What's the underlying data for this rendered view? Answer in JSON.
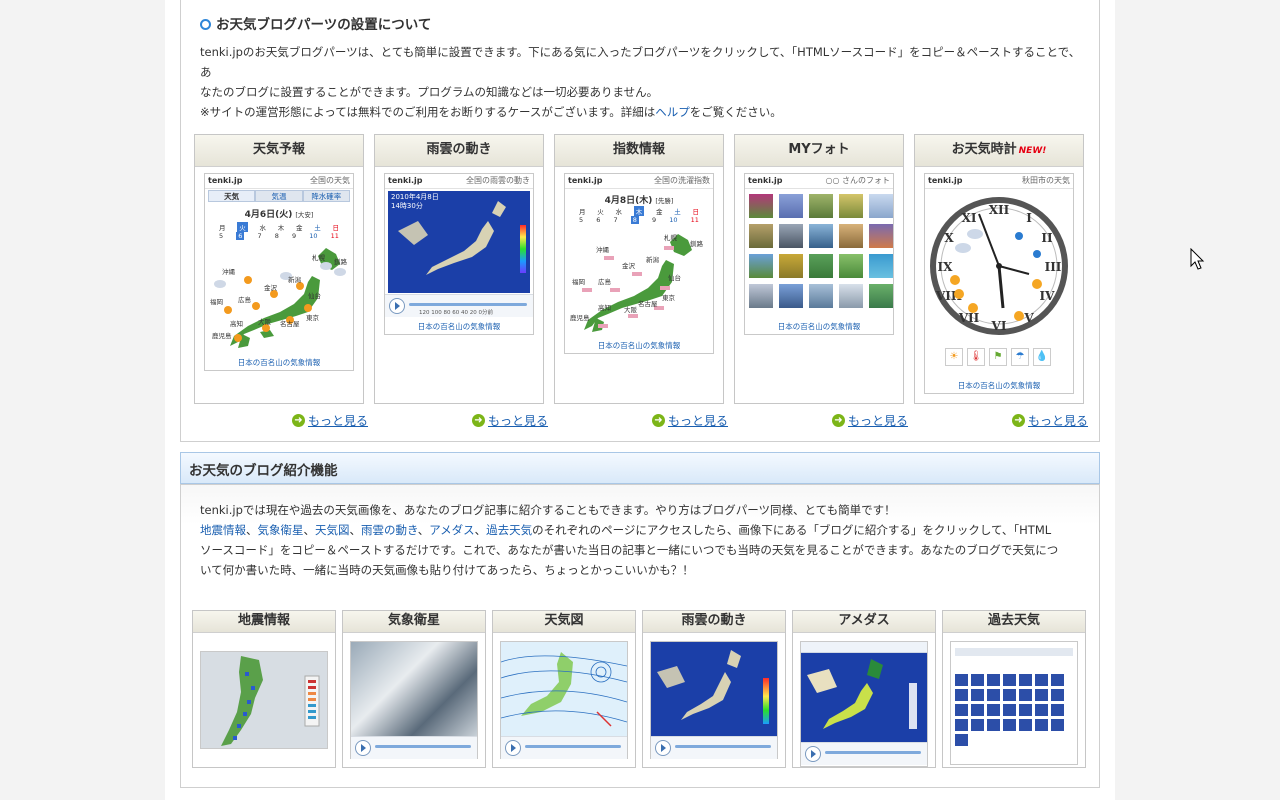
{
  "intro": {
    "title": "お天気ブログパーツの設置について",
    "line1": "tenki.jpのお天気ブログパーツは、とても簡単に設置できます。下にある気に入ったブログパーツをクリックして、「HTMLソースコード」をコピー＆ペーストすることで、あ",
    "line2": "なたのブログに設置することができます。プログラムの知識などは一切必要ありません。",
    "line3_before": "※サイトの運営形態によっては無料でのご利用をお断りするケースがございます。詳細は",
    "line3_link": "ヘルプ",
    "line3_after": "をご覧ください。"
  },
  "parts": [
    {
      "title": "天気予報",
      "widget_brand": "tenki.jp",
      "widget_sub": "全国の天気",
      "footer": "日本の百名山の気象情報",
      "date": "4月6日(火)",
      "extra": "[大安]",
      "tabs": [
        "天気",
        "気温",
        "降水確率"
      ]
    },
    {
      "title": "雨雲の動き",
      "widget_brand": "tenki.jp",
      "widget_sub": "全国の雨雲の動き",
      "footer": "日本の百名山の気象情報",
      "date": "2010年4月8日",
      "time": "14時30分",
      "scale": "120 100 80 60 40 20 0分前"
    },
    {
      "title": "指数情報",
      "widget_brand": "tenki.jp",
      "widget_sub": "全国の洗濯指数",
      "footer": "日本の百名山の気象情報",
      "date": "4月8日(木)",
      "extra": "[先勝]"
    },
    {
      "title": "MYフォト",
      "widget_brand": "tenki.jp",
      "widget_sub": "○○ さんのフォト",
      "footer": "日本の百名山の気象情報"
    },
    {
      "title": "お天気時計",
      "badge": "NEW!",
      "widget_brand": "tenki.jp",
      "widget_sub": "秋田市の天気",
      "footer": "日本の百名山の気象情報"
    }
  ],
  "more_label": "もっと見る",
  "section2": {
    "title": "お天気のブログ紹介機能",
    "line1": "tenki.jpでは現在や過去の天気画像を、あなたのブログ記事に紹介することもできます。やり方はブログパーツ同様、とても簡単です！",
    "links": [
      "地震情報",
      "気象衛星",
      "天気図",
      "雨雲の動き",
      "アメダス",
      "過去天気"
    ],
    "sep": "、",
    "line2_after": "のそれぞれのページにアクセスしたら、画像下にある「ブログに紹介する」をクリックして、「HTML",
    "line3": "ソースコード」をコピー＆ペーストするだけです。これで、あなたが書いた当日の記事と一緒にいつでも当時の天気を見ることができます。あなたのブログで天気につ",
    "line4": "いて何か書いた時、一緒に当時の天気画像も貼り付けてあったら、ちょっとかっこいいかも？！"
  },
  "image_cards": [
    "地震情報",
    "気象衛星",
    "天気図",
    "雨雲の動き",
    "アメダス",
    "過去天気"
  ],
  "weekday_labels": [
    "月",
    "火",
    "水",
    "木",
    "金",
    "土",
    "日"
  ],
  "day_numbers": [
    "5",
    "6",
    "7",
    "8",
    "9",
    "10",
    "11"
  ],
  "city_labels": [
    "沖縄",
    "札幌",
    "釧路",
    "福岡",
    "広島",
    "金沢",
    "新潟",
    "仙台",
    "鹿児島",
    "高知",
    "大阪",
    "名古屋",
    "東京"
  ],
  "index_week_labels": [
    "日",
    "月",
    "火",
    "水",
    "木",
    "金",
    "土"
  ],
  "index_day_numbers": [
    "5",
    "6",
    "7",
    "8",
    "9",
    "10",
    "11"
  ],
  "colors": {
    "link": "#1a5fb0",
    "new_badge": "#e60012",
    "more_icon": "#7cb518",
    "section_head_border": "#a9c7e6"
  }
}
